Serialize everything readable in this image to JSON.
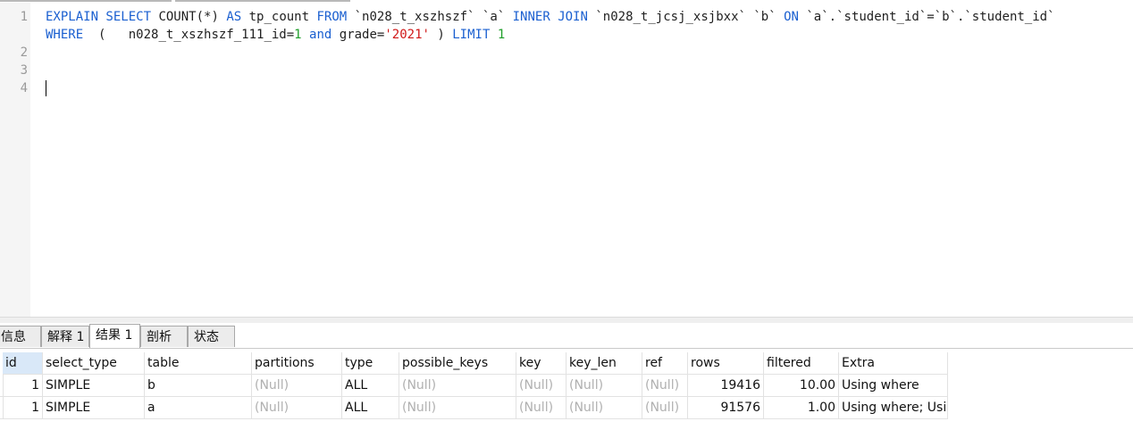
{
  "editor": {
    "line_numbers": [
      "1",
      "",
      "2",
      "3",
      "4"
    ],
    "line1": {
      "t1": "EXPLAIN SELECT",
      "t2": " COUNT(*) ",
      "t3": "AS",
      "t4": " tp_count ",
      "t5": "FROM",
      "t6": " `n028_t_xszhszf` `a` ",
      "t7": "INNER JOIN",
      "t8": " `n028_t_jcsj_xsjbxx` `b` ",
      "t9": "ON",
      "t10": " `a`.`student_id`=`b`.`student_id`"
    },
    "line1b": {
      "t1": "WHERE",
      "t2": "  (   n028_t_xszhszf_111_id=",
      "t3": "1",
      "t4": " ",
      "t5": "and",
      "t6": " grade=",
      "t7": "'2021'",
      "t8": " ) ",
      "t9": "LIMIT",
      "t10": " ",
      "t11": "1"
    }
  },
  "tabs": [
    "信息",
    "解释 1",
    "结果 1",
    "剖析",
    "状态"
  ],
  "active_tab": "结果 1",
  "grid": {
    "columns": [
      "id",
      "select_type",
      "table",
      "partitions",
      "type",
      "possible_keys",
      "key",
      "key_len",
      "ref",
      "rows",
      "filtered",
      "Extra"
    ],
    "rows": [
      [
        "1",
        "SIMPLE",
        "b",
        "(Null)",
        "ALL",
        "(Null)",
        "(Null)",
        "(Null)",
        "(Null)",
        "19416",
        "10.00",
        "Using where"
      ],
      [
        "1",
        "SIMPLE",
        "a",
        "(Null)",
        "ALL",
        "(Null)",
        "(Null)",
        "(Null)",
        "(Null)",
        "91576",
        "1.00",
        "Using where; Usi"
      ]
    ]
  },
  "colors": {
    "keyword": "#1a5fd0",
    "string": "#d01818",
    "number": "#1e9e2a",
    "selected_header": "#d9e8f8"
  }
}
